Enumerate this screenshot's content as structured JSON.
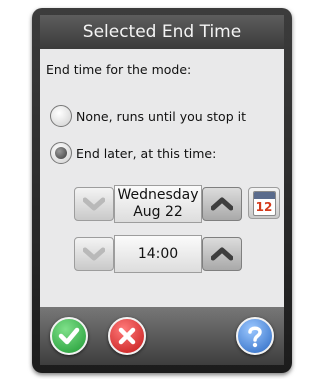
{
  "dialog": {
    "title": "Selected End Time",
    "prompt": "End time for the mode:"
  },
  "options": [
    {
      "label": "None, runs until you stop it",
      "selected": false
    },
    {
      "label": "End later, at this time:",
      "selected": true
    }
  ],
  "date": {
    "line1": "Wednesday",
    "line2": "Aug 22"
  },
  "time": {
    "value": "14:00"
  },
  "calendar": {
    "day": "12"
  },
  "colors": {
    "ok": "#3bb54a",
    "cancel": "#d92a2a",
    "help": "#3d7fd6"
  },
  "icons": {
    "ok": "checkmark-icon",
    "cancel": "close-icon",
    "help": "question-mark-icon",
    "calendar": "calendar-icon",
    "increase": "chevron-up-icon",
    "decrease": "chevron-down-icon"
  }
}
